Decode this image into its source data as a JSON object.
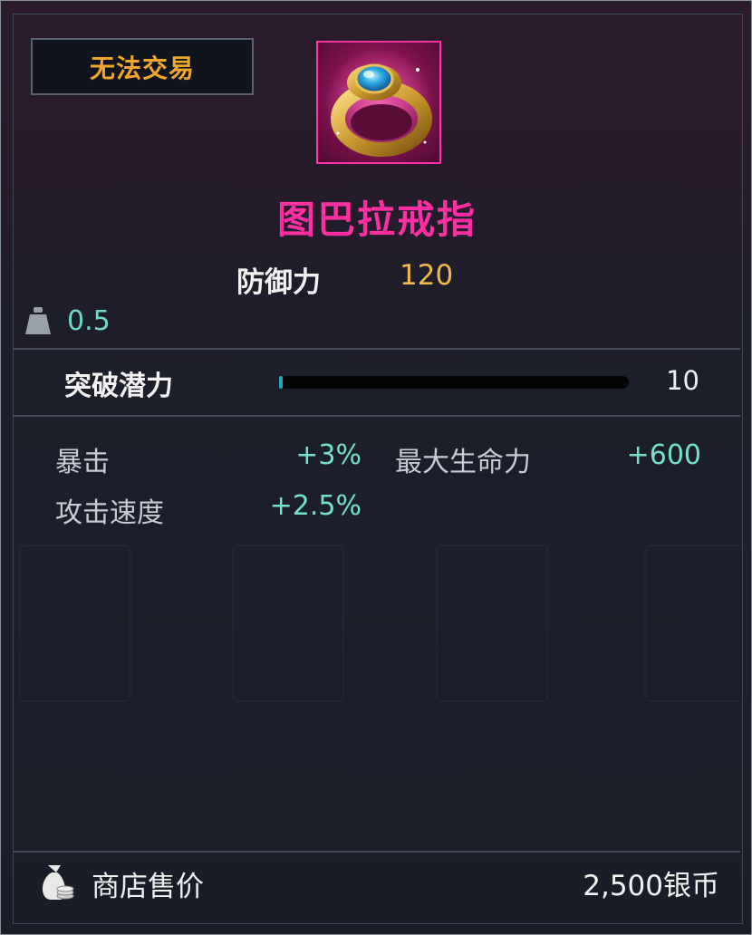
{
  "trade_badge": "无法交易",
  "item": {
    "name": "图巴拉戒指",
    "icon": "ring-icon",
    "rarity_color": "#ff2fa3"
  },
  "main_stat": {
    "label": "防御力",
    "value": "120"
  },
  "weight": {
    "icon": "weight-icon",
    "value": "0.5"
  },
  "breakthrough": {
    "label": "突破潜力",
    "value": "10",
    "progress_fraction": 0.01
  },
  "stats": [
    {
      "label": "暴击",
      "value": "+3%"
    },
    {
      "label": "最大生命力",
      "value": "+600"
    },
    {
      "label": "攻击速度",
      "value": "+2.5%"
    }
  ],
  "price": {
    "icon": "money-bag-icon",
    "label": "商店售价",
    "value": "2,500银币"
  },
  "colors": {
    "badge_text": "#f0a52b",
    "stat_value": "#74e1c9",
    "defense_value": "#f2b94a"
  }
}
